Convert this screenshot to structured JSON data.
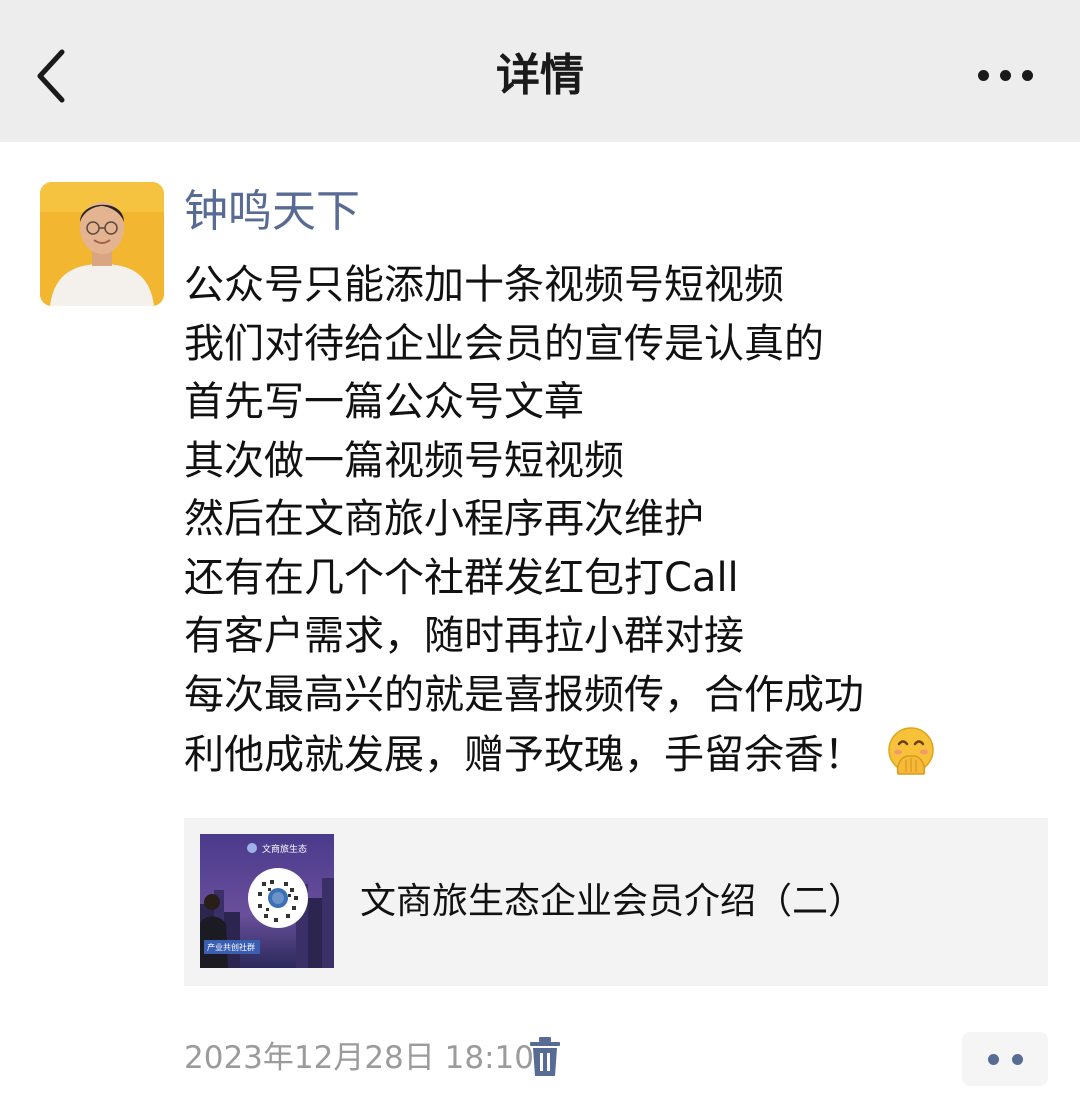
{
  "header": {
    "title": "详情",
    "back_icon": "chevron-left-icon",
    "more_icon": "more-horizontal-icon"
  },
  "post": {
    "author": "钟鸣天下",
    "lines": [
      "公众号只能添加十条视频号短视频",
      "我们对待给企业会员的宣传是认真的",
      "首先写一篇公众号文章",
      "其次做一篇视频号短视频",
      "然后在文商旅小程序再次维护",
      "还有在几个个社群发红包打Call",
      "有客户需求，随时再拉小群对接",
      "每次最高兴的就是喜报频传，合作成功",
      "利他成就发展，赠予玫瑰，手留余香！"
    ],
    "emoji": "face-with-hand-over-mouth-emoji",
    "link_card": {
      "thumb_header": "文商旅生态",
      "thumb_badge": "产业共创社群",
      "title": "文商旅生态企业会员介绍（二）"
    },
    "timestamp": "2023年12月28日 18:10",
    "delete_icon": "trash-icon",
    "action_icon": "more-dots-icon"
  },
  "colors": {
    "header_bg": "#ededed",
    "author_link": "#576b95",
    "timestamp": "#9b9b9b",
    "card_bg": "#f3f3f3"
  }
}
